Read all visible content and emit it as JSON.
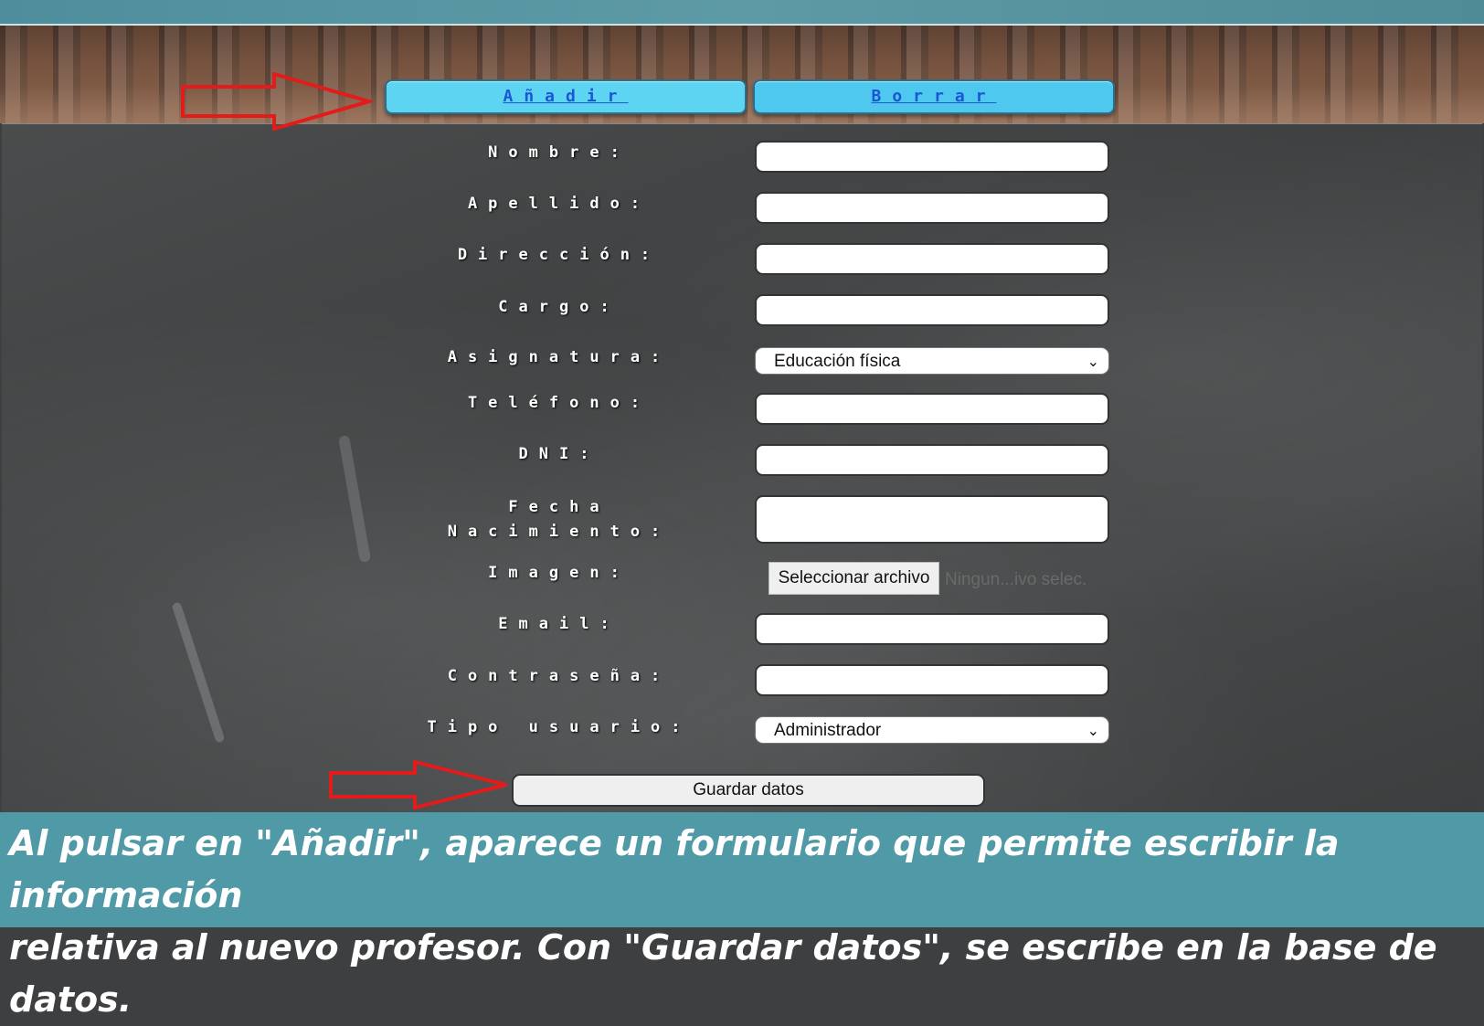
{
  "tabs": {
    "add_label": "Añadir",
    "delete_label": "Borrar"
  },
  "form": {
    "labels": {
      "nombre": "Nombre:",
      "apellido": "Apellido:",
      "direccion": "Dirección:",
      "cargo": "Cargo:",
      "asignatura": "Asignatura:",
      "telefono": "Teléfono:",
      "dni": "DNI:",
      "fecha_line1": "Fecha",
      "fecha_line2": "Nacimiento:",
      "imagen": "Imagen:",
      "email": "Email:",
      "contrasena": "Contraseña:",
      "tipo_usuario": "Tipo usuario:"
    },
    "values": {
      "nombre": "",
      "apellido": "",
      "direccion": "",
      "cargo": "",
      "telefono": "",
      "dni": "",
      "fecha_nacimiento": "",
      "email": "",
      "contrasena": ""
    },
    "asignatura_selected": "Educación física",
    "tipo_usuario_selected": "Administrador",
    "file_button_label": "Seleccionar archivo",
    "file_status": "Ningun...ivo selec.",
    "save_label": "Guardar datos"
  },
  "caption": {
    "line1": "Al pulsar en \"Añadir\", aparece un formulario que permite escribir la información",
    "line2": "relativa al nuevo profesor. Con \"Guardar datos\", se escribe en la base de datos."
  },
  "colors": {
    "tab_add_bg": "#5dd5f2",
    "tab_delete_bg": "#4ec8ee",
    "tab_text": "#1c55d6",
    "arrow": "#e21b1b",
    "caption_bg": "#4f9aa6"
  },
  "icons": {
    "arrow": "red-outline-arrow-icon",
    "dropdown": "chevron-down-icon"
  }
}
